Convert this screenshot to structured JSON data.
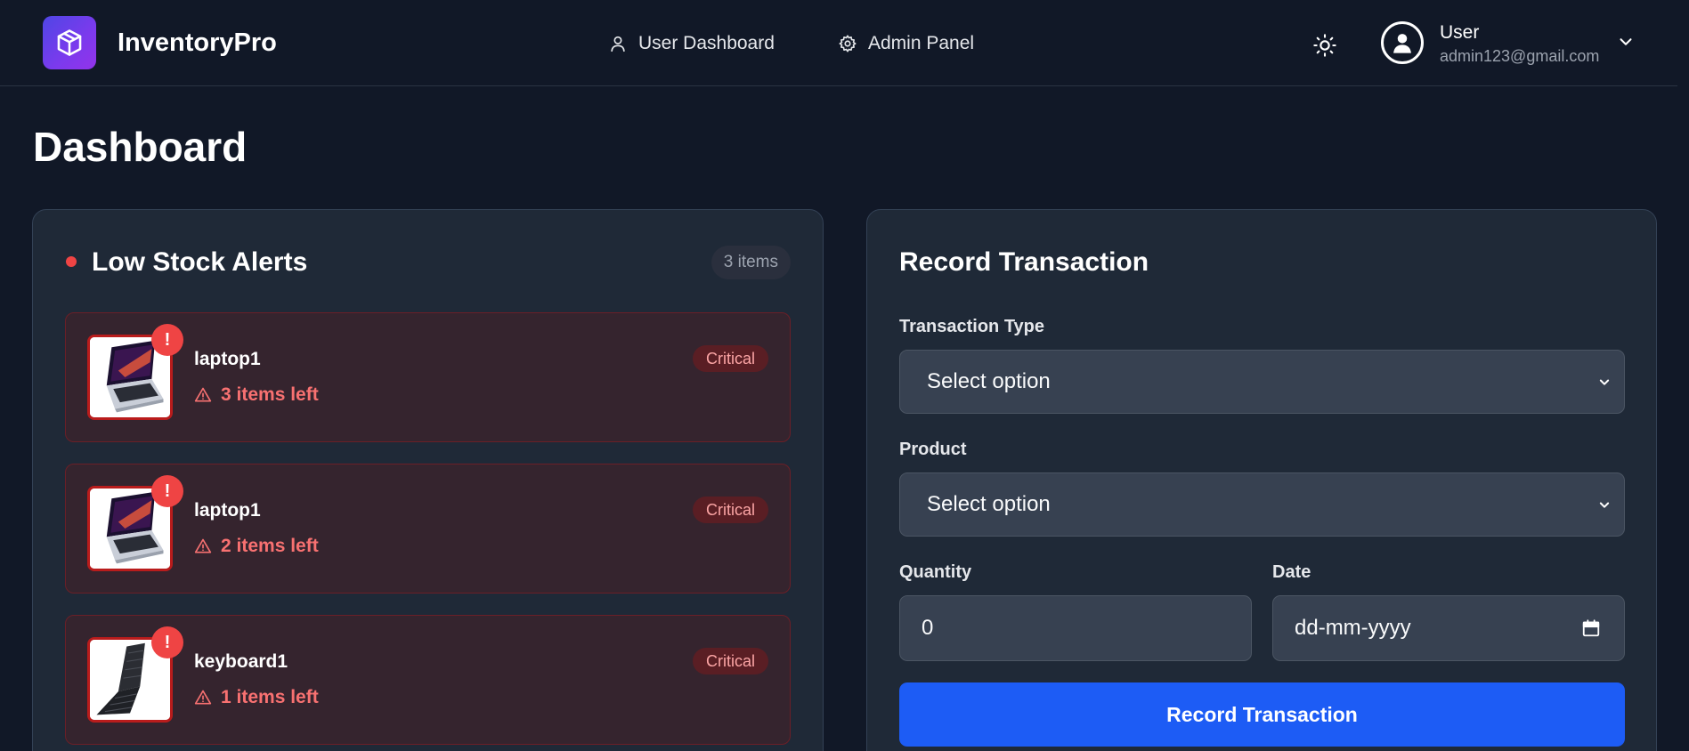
{
  "app": {
    "brand": "InventoryPro"
  },
  "nav": {
    "user_dashboard": "User Dashboard",
    "admin_panel": "Admin Panel"
  },
  "user": {
    "name": "User",
    "email": "admin123@gmail.com"
  },
  "page": {
    "title": "Dashboard"
  },
  "low_stock": {
    "title": "Low Stock Alerts",
    "count_label": "3 items",
    "items": [
      {
        "name": "laptop1",
        "stock_text": "3 items left",
        "badge": "Critical",
        "image": "laptop"
      },
      {
        "name": "laptop1",
        "stock_text": "2 items left",
        "badge": "Critical",
        "image": "laptop"
      },
      {
        "name": "keyboard1",
        "stock_text": "1 items left",
        "badge": "Critical",
        "image": "keyboard"
      }
    ]
  },
  "transaction_form": {
    "title": "Record Transaction",
    "type_label": "Transaction Type",
    "type_value": "Select option",
    "product_label": "Product",
    "product_value": "Select option",
    "quantity_label": "Quantity",
    "quantity_value": "0",
    "date_label": "Date",
    "date_placeholder": "dd-mm-yyyy",
    "submit_label": "Record Transaction"
  },
  "icons": {
    "logo": "cube-icon",
    "user_dashboard": "user-icon",
    "admin_panel": "gear-icon",
    "theme": "sun-icon",
    "avatar": "user-circle-icon",
    "menu": "chevron-down-icon",
    "alert": "warning-triangle-icon",
    "date": "calendar-icon"
  },
  "colors": {
    "background": "#111827",
    "panel": "#1f2937",
    "accent": "#1d5cf5",
    "danger": "#ef4444",
    "logo_gradient_start": "#4f46e5",
    "logo_gradient_end": "#9333ea"
  }
}
